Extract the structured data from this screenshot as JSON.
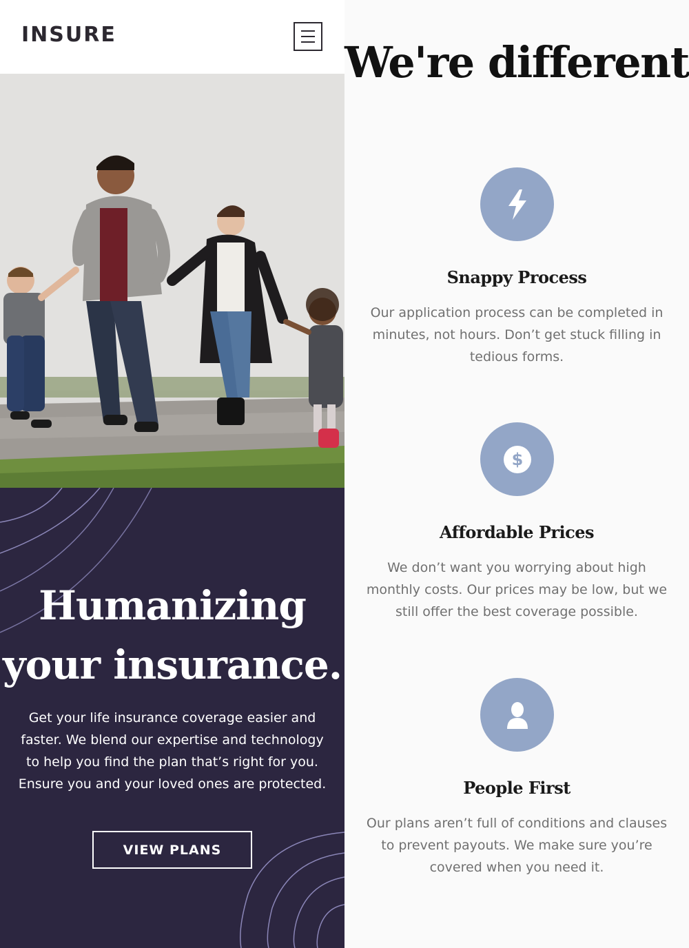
{
  "header": {
    "logo": "INSURE",
    "menu_icon": "hamburger-menu-icon"
  },
  "photo": {
    "icon": "family-photo"
  },
  "hero": {
    "title_line1": "Humanizing",
    "title_line2": "your insurance.",
    "text": "Get your life insurance coverage easier and faster. We blend our expertise and technology to help you find the plan that’s right for you. Ensure you and your loved ones are protected.",
    "button_label": "VIEW PLANS"
  },
  "features": {
    "title": "We're different",
    "items": [
      {
        "icon": "lightning-icon",
        "title": "Snappy Process",
        "text": "Our application process can be completed in minutes, not hours. Don’t get stuck filling in tedious forms."
      },
      {
        "icon": "dollar-icon",
        "title": "Affordable Prices",
        "text": "We don’t want you worrying about high monthly costs. Our prices may be low, but we still offer the best coverage possible."
      },
      {
        "icon": "person-icon",
        "title": "People First",
        "text": "Our plans aren’t full of conditions and clauses to prevent payouts. We make sure you’re covered when you need it."
      }
    ]
  },
  "colors": {
    "dark_violet": "#2c2640",
    "icon_blue": "#93a6c7",
    "text_gray": "#707070"
  }
}
